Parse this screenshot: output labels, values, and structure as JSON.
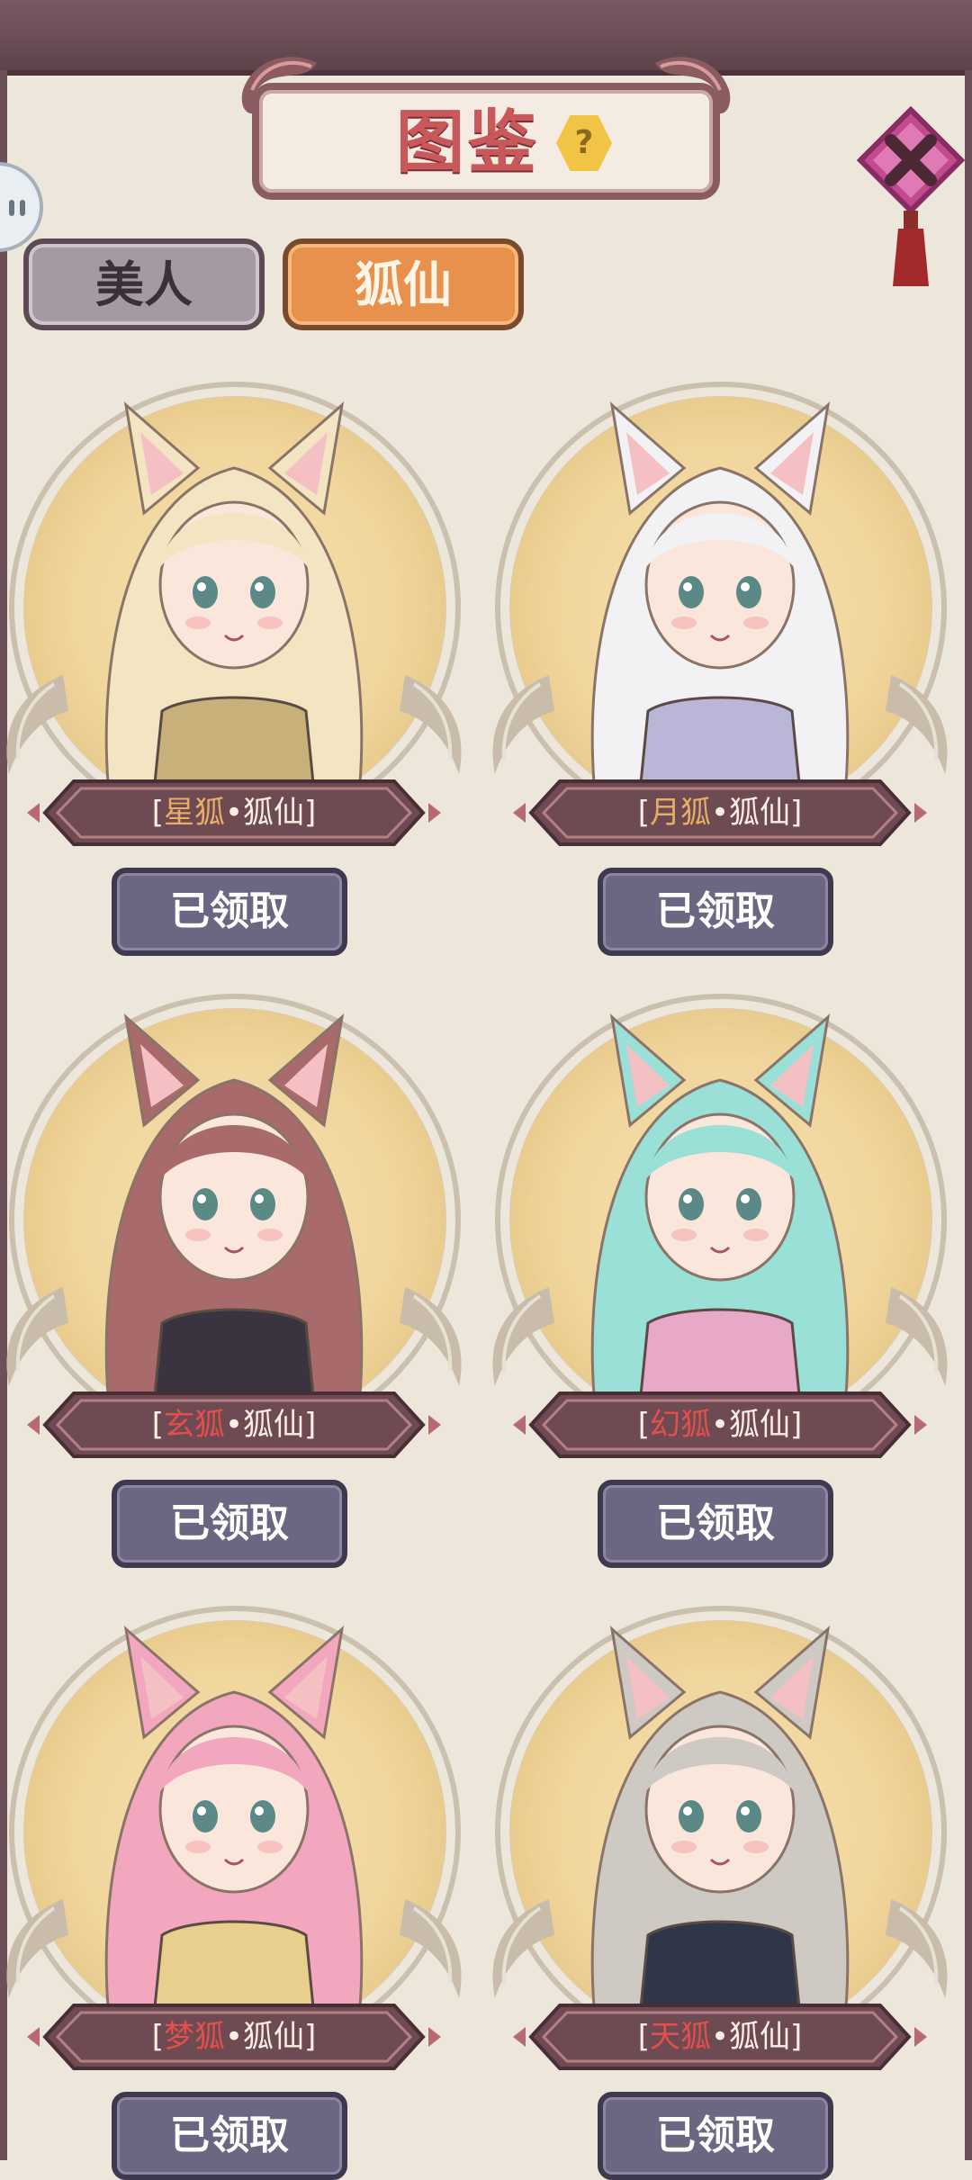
{
  "header": {
    "title": "图鉴",
    "help_symbol": "?"
  },
  "tabs": [
    {
      "label": "美人",
      "active": false
    },
    {
      "label": "狐仙",
      "active": true
    }
  ],
  "cards": [
    {
      "prefix": "星狐",
      "sep": "•",
      "suffix": "狐仙",
      "prefix_color": "gold",
      "button": "已领取",
      "hair": "#f3e4c2",
      "outfit": "#c7b07a"
    },
    {
      "prefix": "月狐",
      "sep": "•",
      "suffix": "狐仙",
      "prefix_color": "gold",
      "button": "已领取",
      "hair": "#f2f2f4",
      "outfit": "#b9b6d8"
    },
    {
      "prefix": "玄狐",
      "sep": "•",
      "suffix": "狐仙",
      "prefix_color": "red",
      "button": "已领取",
      "hair": "#a86a6a",
      "outfit": "#3a3440"
    },
    {
      "prefix": "幻狐",
      "sep": "•",
      "suffix": "狐仙",
      "prefix_color": "red",
      "button": "已领取",
      "hair": "#9ae0d6",
      "outfit": "#e8a8c8"
    },
    {
      "prefix": "梦狐",
      "sep": "•",
      "suffix": "狐仙",
      "prefix_color": "red",
      "button": "已领取",
      "hair": "#f2a7bf",
      "outfit": "#e9cf8e"
    },
    {
      "prefix": "天狐",
      "sep": "•",
      "suffix": "狐仙",
      "prefix_color": "red",
      "button": "已领取",
      "hair": "#cfc9c4",
      "outfit": "#2e3648"
    }
  ],
  "colors": {
    "background": "#ece6db",
    "frame": "#6b5058",
    "tab_active": "#e8914d",
    "tab_inactive": "#a59aa3",
    "ribbon": "#6e4a52",
    "claim_button": "#6d6682"
  },
  "icons": {
    "help": "help-icon",
    "close": "close-icon",
    "side": "pause-icon"
  }
}
